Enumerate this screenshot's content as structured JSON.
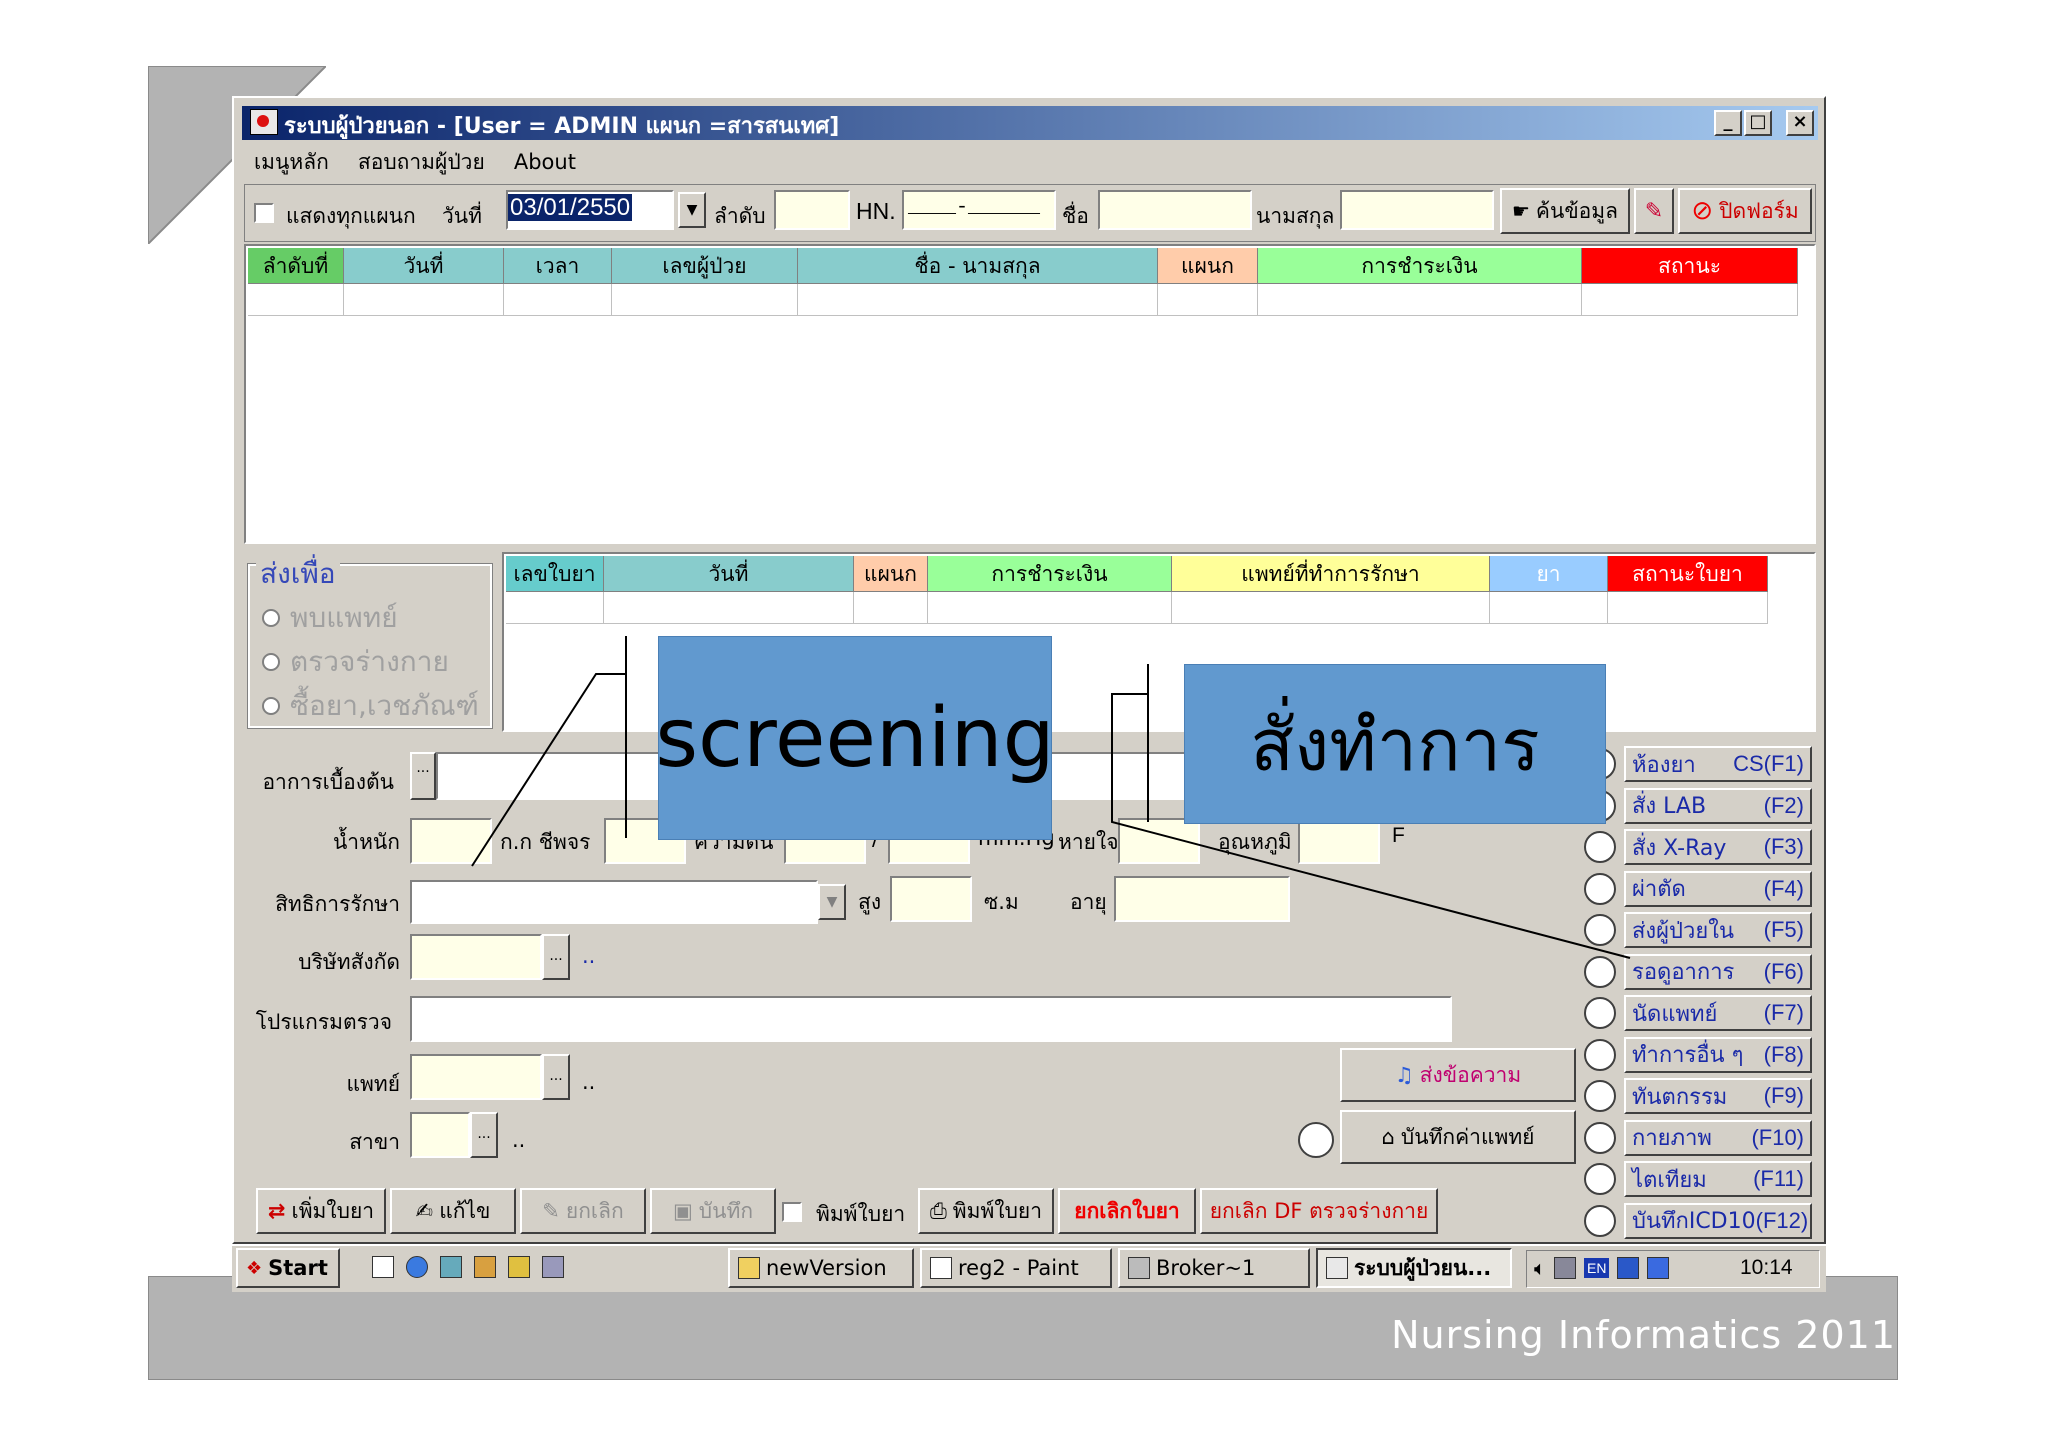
{
  "window": {
    "title": "ระบบผู้ป่วยนอก - [User = ADMIN แผนก =สารสนเทศ]",
    "controls": [
      "_",
      "□",
      "×"
    ]
  },
  "menu": {
    "items": [
      "เมนูหลัก",
      "สอบถามผู้ป่วย",
      "About"
    ]
  },
  "toolbar": {
    "show_all_label": "แสดงทุกแผนก",
    "date_label": "วันที่",
    "date_value": "03/01/2550",
    "order_label": "ลำดับ",
    "hn_label": "HN.",
    "hn_value": "____-______",
    "name_label": "ชื่อ",
    "surname_label": "นามสกุล",
    "search_button": "ค้นข้อมูล",
    "close_button": "ปิดฟอร์ม"
  },
  "patient_table": {
    "columns": [
      {
        "label": "ลำดับที่",
        "color": "#66cc66"
      },
      {
        "label": "วันที่",
        "color": "#88cccc"
      },
      {
        "label": "เวลา",
        "color": "#88cccc"
      },
      {
        "label": "เลขผู้ป่วย",
        "color": "#88cccc"
      },
      {
        "label": "ชื่อ - นามสกุล",
        "color": "#88cccc"
      },
      {
        "label": "แผนก",
        "color": "#ffccaa"
      },
      {
        "label": "การชำระเงิน",
        "color": "#99ff99"
      },
      {
        "label": "สถานะ",
        "color": "#ff0000"
      }
    ]
  },
  "send_group": {
    "title": "ส่งเพื่อ",
    "options": [
      "พบแพทย์",
      "ตรวจร่างกาย",
      "ซื้อยา,เวชภัณฑ์"
    ]
  },
  "rx_table": {
    "columns": [
      {
        "label": "เลขใบยา",
        "color": "#66cccc"
      },
      {
        "label": "วันที่",
        "color": "#88cccc"
      },
      {
        "label": "แผนก",
        "color": "#ffccaa"
      },
      {
        "label": "การชำระเงิน",
        "color": "#99ff99"
      },
      {
        "label": "แพทย์ที่ทำการรักษา",
        "color": "#ffff99"
      },
      {
        "label": "ยา",
        "color": "#99ccff"
      },
      {
        "label": "สถานะใบยา",
        "color": "#ff0000"
      }
    ]
  },
  "form": {
    "symptom_label": "อาการเบื้องต้น",
    "weight_label": "น้ำหนัก",
    "pulse_label": "ก.ก ชีพจร",
    "bp_label": "ความดัน",
    "bp_sep": "/",
    "mmhg_label": "mm.Hg",
    "resp_label": "หายใจ",
    "temp_label": "อุณหภูมิ",
    "temp_unit": "F",
    "right_label": "สิทธิการรักษา",
    "height_label": "สูง",
    "cm_label": "ซ.ม",
    "age_label": "อายุ",
    "company_label": "บริษัทสังกัด",
    "exam_program_label": "โปรแกรมตรวจ",
    "doctor_label": "แพทย์",
    "branch_label": "สาขา",
    "dots": "..",
    "ellipsis": "..."
  },
  "mid_buttons": {
    "send_msg": "ส่งข้อความ",
    "doctor_fee": "บันทึกค่าแพทย์"
  },
  "side_buttons": [
    {
      "label": "ห้องยา",
      "key": "CS(F1)"
    },
    {
      "label": "สั่ง LAB",
      "key": "(F2)"
    },
    {
      "label": "สั่ง X-Ray",
      "key": "(F3)"
    },
    {
      "label": "ผ่าตัด",
      "key": "(F4)"
    },
    {
      "label": "ส่งผู้ป่วยใน",
      "key": "(F5)"
    },
    {
      "label": "รอดูอาการ",
      "key": "(F6)"
    },
    {
      "label": "นัดแพทย์",
      "key": "(F7)"
    },
    {
      "label": "ทำการอื่น ๆ",
      "key": "(F8)"
    },
    {
      "label": "ทันตกรรม",
      "key": "(F9)"
    },
    {
      "label": "กายภาพ",
      "key": "(F10)"
    },
    {
      "label": "ไตเทียม",
      "key": "(F11)"
    },
    {
      "label": "บันทึกICD10",
      "key": "(F12)"
    }
  ],
  "bottom_buttons": {
    "add_rx": "เพิ่มใบยา",
    "edit": "แก้ไข",
    "cancel": "ยกเลิก",
    "save": "บันทึก",
    "print_check_label": "พิมพ์ใบยา",
    "print": "พิมพ์ใบยา",
    "cancel_rx": "ยกเลิกใบยา",
    "cancel_df": "ยกเลิก DF ตรวจร่างกาย"
  },
  "annotations": {
    "screening": "screening",
    "order": "สั่งทำการ"
  },
  "taskbar": {
    "start": "Start",
    "tasks": [
      "newVersion",
      "reg2 - Paint",
      "Broker~1",
      "ระบบผู้ป่วยน..."
    ],
    "lang": "EN",
    "clock": "10:14"
  },
  "slide_footer": "Nursing Informatics 2011"
}
